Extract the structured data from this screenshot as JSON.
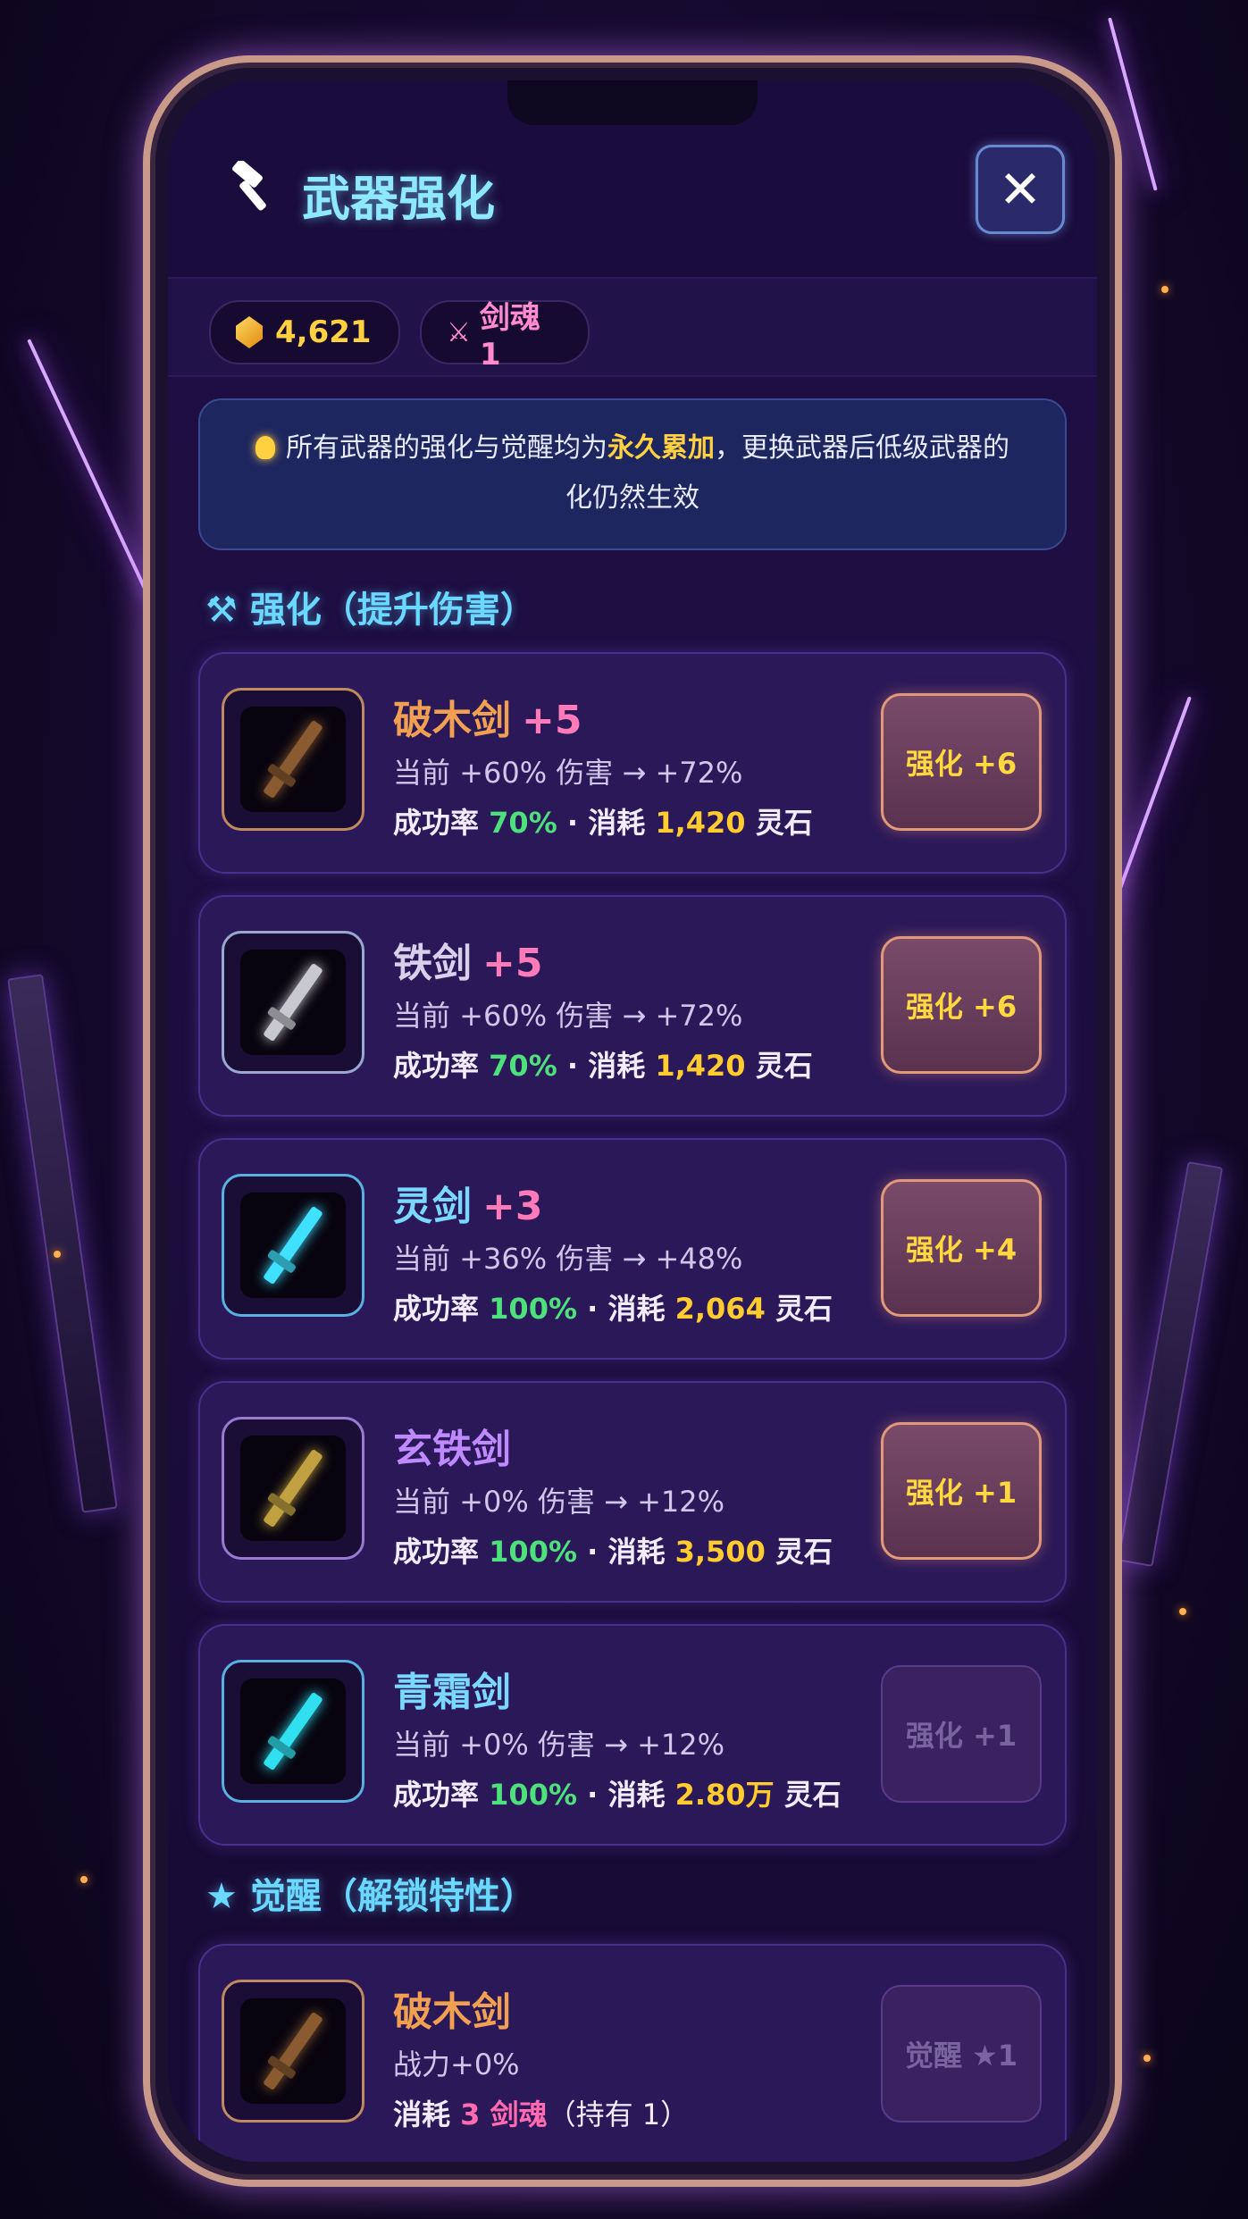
{
  "header": {
    "title": "武器强化",
    "close_label": "✕"
  },
  "currency": {
    "gems": "4,621",
    "soul_label": "剑魂 1"
  },
  "notice": {
    "text_before": "所有武器的强化与觉醒均为",
    "highlight": "永久累加",
    "text_after": "，更换武器后低级武器的化仍然生效"
  },
  "sections": {
    "enhance_title": "强化（提升伤害）",
    "awaken_title": "觉醒（解锁特性）"
  },
  "enhance_items": [
    {
      "name": "破木剑",
      "level": "+5",
      "name_color": "#f0a050",
      "current": "当前 +60% 伤害 → +72%",
      "rate_label": "成功率",
      "rate": "70%",
      "cost_label": "消耗",
      "cost": "1,420",
      "currency": "灵石",
      "button": "强化 +6",
      "enabled": true,
      "blade": "#8a5a30",
      "frame": "#c08a60"
    },
    {
      "name": "铁剑",
      "level": "+5",
      "name_color": "#d8d0ea",
      "current": "当前 +60% 伤害 → +72%",
      "rate_label": "成功率",
      "rate": "70%",
      "cost_label": "消耗",
      "cost": "1,420",
      "currency": "灵石",
      "button": "强化 +6",
      "enabled": true,
      "blade": "#c8c8d0",
      "frame": "#9aa8d0"
    },
    {
      "name": "灵剑",
      "level": "+3",
      "name_color": "#7ad8ff",
      "current": "当前 +36% 伤害 → +48%",
      "rate_label": "成功率",
      "rate": "100%",
      "cost_label": "消耗",
      "cost": "2,064",
      "currency": "灵石",
      "button": "强化 +4",
      "enabled": true,
      "blade": "#40e0ff",
      "frame": "#5ab0e0"
    },
    {
      "name": "玄铁剑",
      "level": "",
      "name_color": "#c08aff",
      "current": "当前 +0% 伤害 → +12%",
      "rate_label": "成功率",
      "rate": "100%",
      "cost_label": "消耗",
      "cost": "3,500",
      "currency": "灵石",
      "button": "强化 +1",
      "enabled": true,
      "blade": "#c0a040",
      "frame": "#9a7ad0"
    },
    {
      "name": "青霜剑",
      "level": "",
      "name_color": "#7ad8ff",
      "current": "当前 +0% 伤害 → +12%",
      "rate_label": "成功率",
      "rate": "100%",
      "cost_label": "消耗",
      "cost": "2.80万",
      "currency": "灵石",
      "button": "强化 +1",
      "enabled": false,
      "blade": "#30e0f0",
      "frame": "#5ab0e0"
    }
  ],
  "awaken_item": {
    "name": "破木剑",
    "name_color": "#f0a050",
    "power": "战力+0%",
    "cost_label": "消耗",
    "cost": "3 剑魂",
    "owned": "（持有 1）",
    "button": "觉醒 ★1",
    "enabled": false,
    "blade": "#8a5a30",
    "frame": "#c08a60"
  },
  "colors": {
    "accent": "#6ad8ff",
    "gold": "#ffcc30",
    "success": "#4ee07a",
    "pink": "#ff6ab0"
  }
}
